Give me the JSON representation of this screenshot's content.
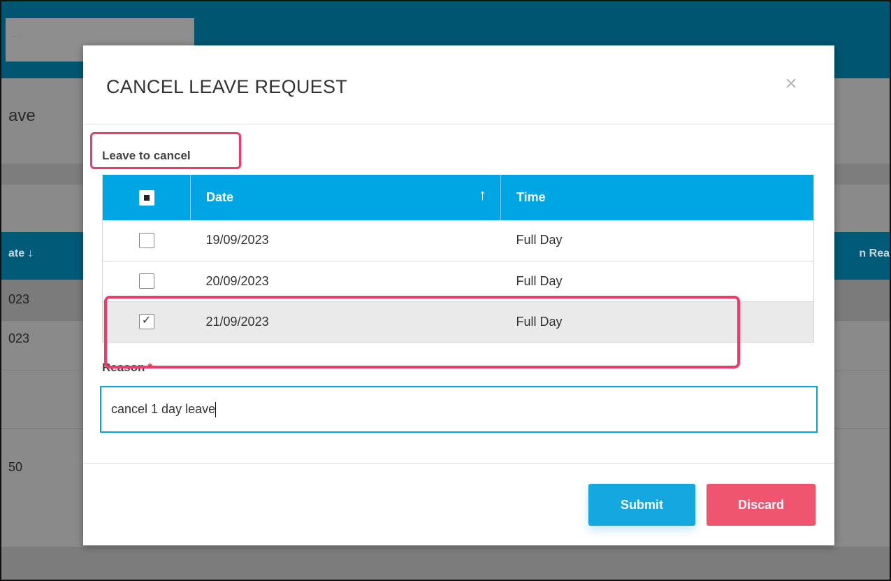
{
  "background": {
    "search_placeholder": "...",
    "page_title_fragment": "ave",
    "col_left_fragment": "ate  ↓",
    "col_right_fragment": "n Rea",
    "rows": [
      "023",
      "023"
    ],
    "bottom_fragment": "50"
  },
  "modal": {
    "title": "CANCEL LEAVE REQUEST",
    "close_glyph": "×",
    "section_label": "Leave to cancel",
    "table": {
      "columns": [
        "Date",
        "Time"
      ],
      "sort_glyph": "↑",
      "rows": [
        {
          "date": "19/09/2023",
          "time": "Full Day",
          "checked": false
        },
        {
          "date": "20/09/2023",
          "time": "Full Day",
          "checked": false
        },
        {
          "date": "21/09/2023",
          "time": "Full Day",
          "checked": true
        }
      ]
    },
    "reason_label": "Reason",
    "required_marker": "*",
    "reason_value": "cancel 1 day leave",
    "submit_label": "Submit",
    "discard_label": "Discard"
  },
  "colors": {
    "header_blue": "#00a5e3",
    "highlight_pink": "#ee3b6b",
    "discard_red": "#f0556f",
    "submit_blue": "#15a7df"
  }
}
